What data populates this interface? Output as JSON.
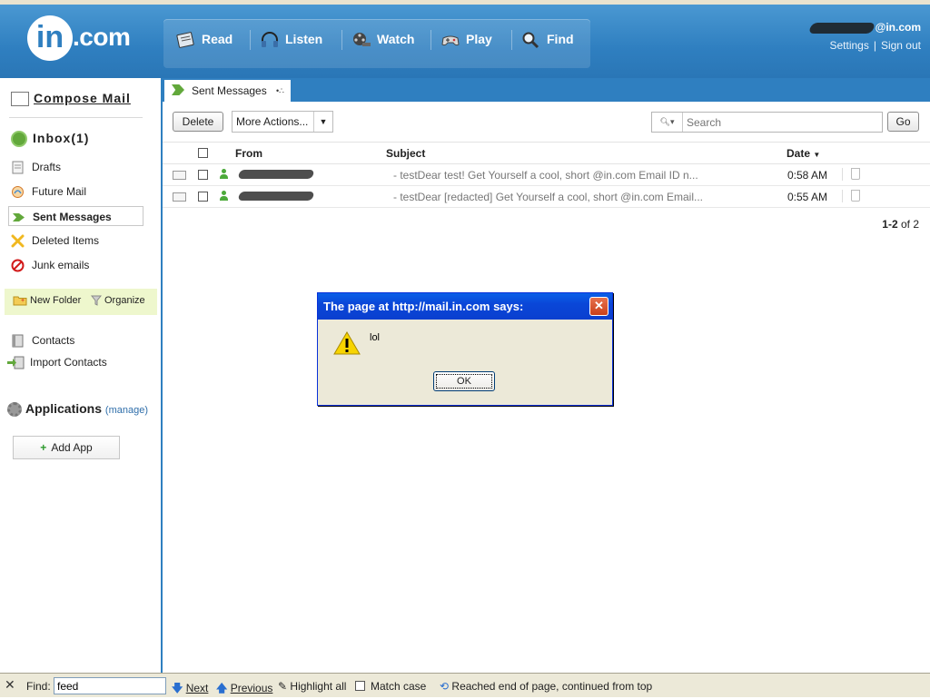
{
  "header": {
    "logo_text": "in.com",
    "nav": [
      {
        "label": "Read",
        "icon": "newspaper-icon"
      },
      {
        "label": "Listen",
        "icon": "headphones-icon"
      },
      {
        "label": "Watch",
        "icon": "film-reel-icon"
      },
      {
        "label": "Play",
        "icon": "gamepad-icon"
      },
      {
        "label": "Find",
        "icon": "magnifier-icon"
      }
    ],
    "account": {
      "email_suffix": "@in.com",
      "settings": "Settings",
      "separator": "|",
      "signout": "Sign out"
    }
  },
  "sidebar": {
    "compose": "Compose Mail",
    "inbox": "Inbox(1)",
    "folders": [
      {
        "label": "Drafts",
        "icon": "drafts-icon"
      },
      {
        "label": "Future Mail",
        "icon": "future-mail-icon"
      },
      {
        "label": "Sent Messages",
        "icon": "sent-arrow-icon",
        "active": true
      },
      {
        "label": "Deleted Items",
        "icon": "deleted-x-icon"
      },
      {
        "label": "Junk emails",
        "icon": "junk-no-icon"
      }
    ],
    "new_folder": "New Folder",
    "organize": "Organize",
    "contacts": "Contacts",
    "import_contacts": "Import Contacts",
    "applications": "Applications",
    "manage": "(manage)",
    "add_app": "Add App"
  },
  "main": {
    "tab_label": "Sent Messages",
    "toolbar": {
      "delete": "Delete",
      "more_actions": "More Actions...",
      "search_placeholder": "Search",
      "go": "Go"
    },
    "columns": {
      "from": "From",
      "subject": "Subject",
      "date": "Date"
    },
    "messages": [
      {
        "from": "[redacted]",
        "subject": "- testDear test! Get Yourself a cool, short @in.com Email ID n...",
        "date": "0:58 AM"
      },
      {
        "from": "[redacted]",
        "subject": "- testDear [redacted] Get Yourself a cool, short @in.com Email...",
        "date": "0:55 AM"
      }
    ],
    "paging": {
      "range": "1-2",
      "of": "of 2"
    }
  },
  "dialog": {
    "title": "The page at http://mail.in.com says:",
    "message": "lol",
    "ok": "OK"
  },
  "findbar": {
    "label": "Find:",
    "value": "feed",
    "next": "Next",
    "previous": "Previous",
    "highlight_all": "Highlight all",
    "match_case": "Match case",
    "status": "Reached end of page, continued from top"
  },
  "colors": {
    "header_blue": "#2f7fc0",
    "accent_green": "#62a83b",
    "dialog_titlebar": "#0a47d8",
    "findbar_bg": "#ece9d8"
  }
}
